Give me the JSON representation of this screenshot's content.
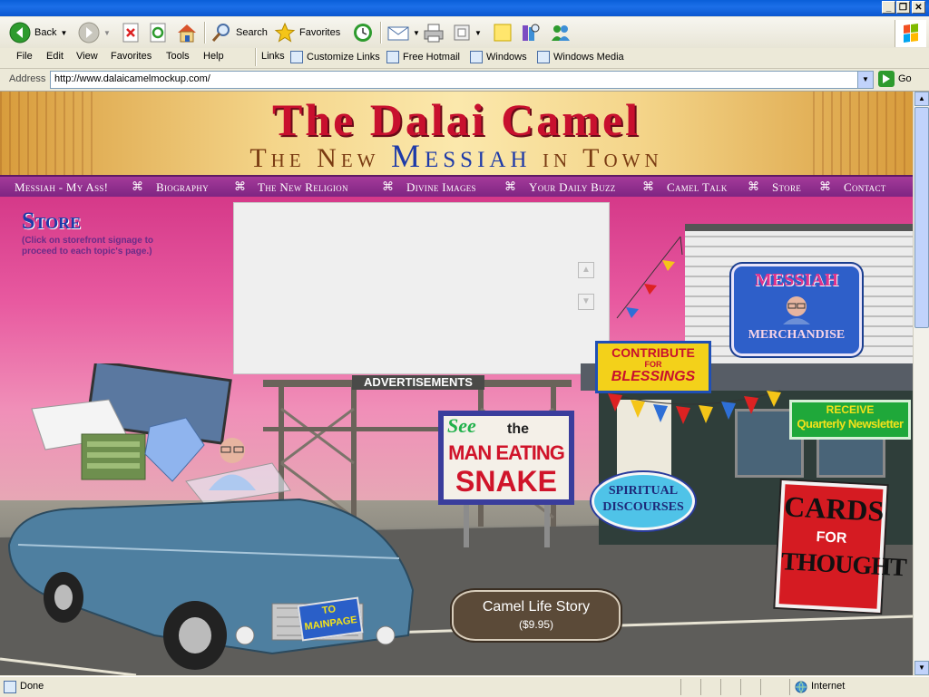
{
  "browser": {
    "toolbar": {
      "back_label": "Back",
      "search_label": "Search",
      "favorites_label": "Favorites"
    },
    "menu": [
      "File",
      "Edit",
      "View",
      "Favorites",
      "Tools",
      "Help"
    ],
    "links_label": "Links",
    "links": [
      "Customize Links",
      "Free Hotmail",
      "Windows",
      "Windows Media"
    ],
    "address_label": "Address",
    "address_value": "http://www.dalaicamelmockup.com/",
    "go_label": "Go",
    "status_text": "Done",
    "zone_text": "Internet"
  },
  "site": {
    "title": "The Dalai Camel",
    "tagline_pre": "The New",
    "tagline_mid": "Messiah",
    "tagline_post": "in Town",
    "nav": [
      "Messiah - My Ass!",
      "Biography",
      "The New Religion",
      "Divine Images",
      "Your Daily Buzz",
      "Camel Talk",
      "Store",
      "Contact"
    ],
    "nav_separator": "⌘",
    "page_heading": "Store",
    "page_hint": "(Click on storefront signage to proceed to each topic's page.)"
  },
  "scene": {
    "billboard_label": "ADVERTISEMENTS",
    "store_sign_line1": "MESSIAH",
    "store_sign_line2": "MERCHANDISE",
    "contribute_line1": "CONTRIBUTE",
    "contribute_line2": "FOR",
    "contribute_line3": "BLESSINGS",
    "newsletter_line1": "RECEIVE",
    "newsletter_line2": "Quarterly Newsletter",
    "snake_see": "See",
    "snake_the": "the",
    "snake_line1": "MAN EATING",
    "snake_line2": "SNAKE",
    "discourses_line1": "SPIRITUAL",
    "discourses_line2": "DISCOURSES",
    "cards_line1": "CARDS",
    "cards_line2": "FOR",
    "cards_line3": "THOUGHT",
    "plate_line1": "TO",
    "plate_line2": "MAINPAGE",
    "lifestory_line1": "Camel Life Story",
    "lifestory_line2": "($9.95)"
  },
  "colors": {
    "nav_bg": "#8E2B8F",
    "sky_pink": "#E85AA0",
    "title_red": "#C8102E",
    "messiah_blue": "#1E3AA8"
  }
}
